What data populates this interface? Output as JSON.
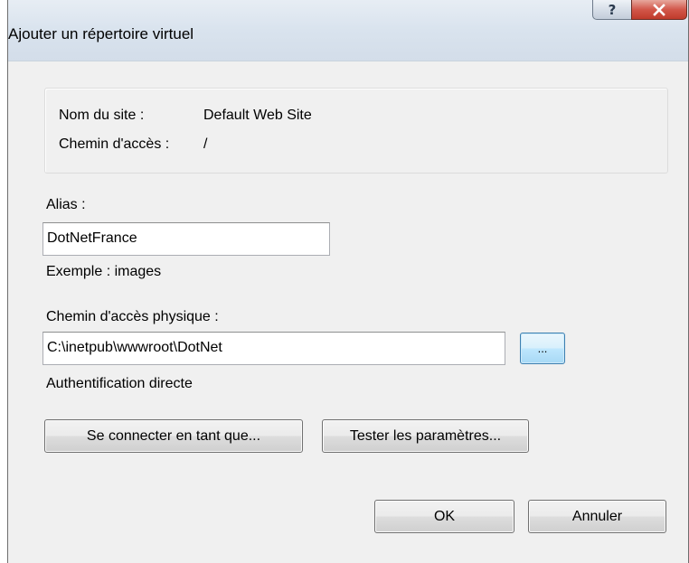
{
  "window": {
    "title": "Ajouter un répertoire virtuel",
    "help_glyph": "?",
    "close_glyph": "X"
  },
  "site_info": {
    "site_name_label": "Nom du site :",
    "site_name_value": "Default Web Site",
    "path_label": "Chemin d'accès :",
    "path_value": "/"
  },
  "alias": {
    "label": "Alias :",
    "value": "DotNetFrance",
    "example": "Exemple : images"
  },
  "physical_path": {
    "label": "Chemin d'accès physique :",
    "value": "C:\\inetpub\\wwwroot\\DotNet",
    "browse_label": "..."
  },
  "auth": {
    "label": "Authentification directe",
    "connect_as_label": "Se connecter en tant que...",
    "test_settings_label": "Tester les paramètres..."
  },
  "footer": {
    "ok_label": "OK",
    "cancel_label": "Annuler"
  },
  "colors": {
    "dialog_bg": "#f0f0f0",
    "title_bg": "#dae3ee",
    "close_button": "#c8463a",
    "focus_border": "#3c7fb1"
  }
}
